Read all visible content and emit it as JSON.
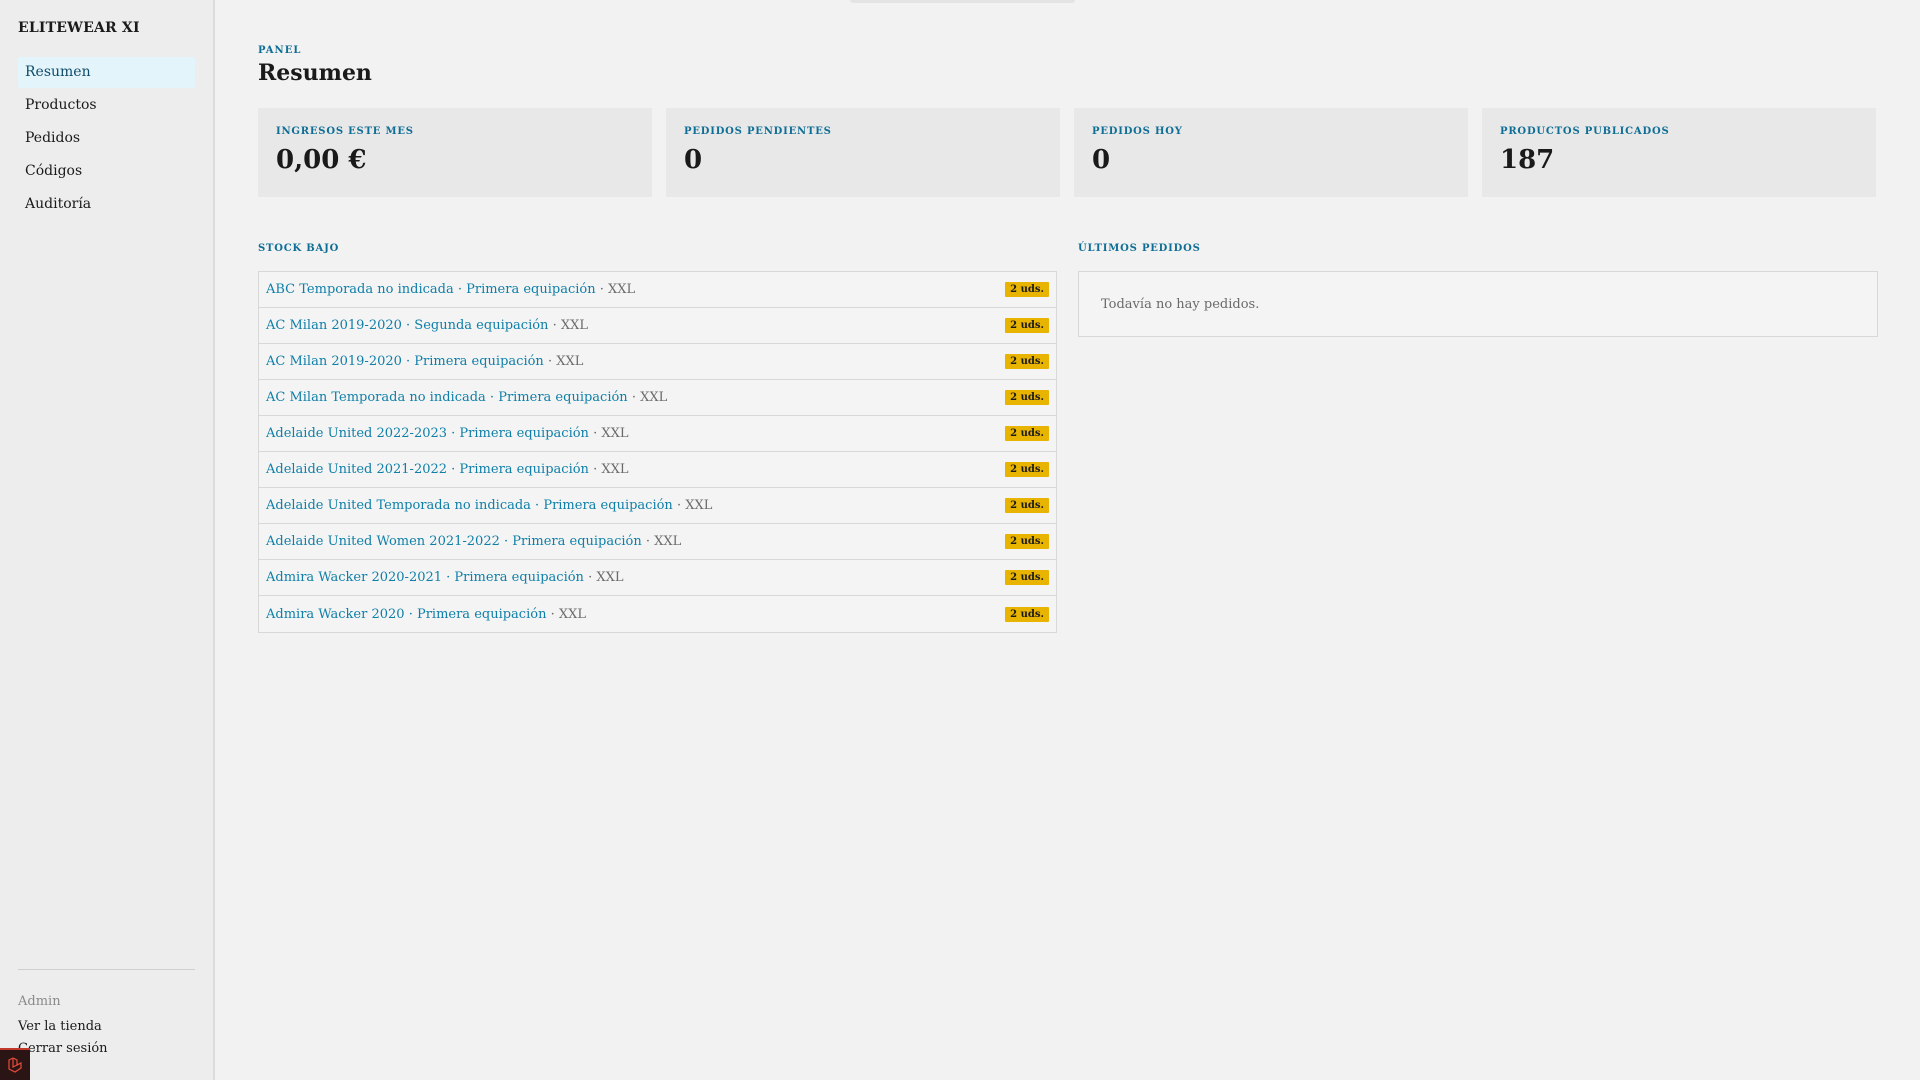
{
  "brand": "ELITEWEAR XI",
  "nav": [
    {
      "label": "Resumen",
      "active": true,
      "name": "nav-item-resumen"
    },
    {
      "label": "Productos",
      "active": false,
      "name": "nav-item-productos"
    },
    {
      "label": "Pedidos",
      "active": false,
      "name": "nav-item-pedidos"
    },
    {
      "label": "Códigos",
      "active": false,
      "name": "nav-item-codigos"
    },
    {
      "label": "Auditoría",
      "active": false,
      "name": "nav-item-auditoria"
    }
  ],
  "footer": {
    "role": "Admin",
    "view_store": "Ver la tienda",
    "logout": "Cerrar sesión"
  },
  "header": {
    "eyebrow": "PANEL",
    "title": "Resumen"
  },
  "stats": [
    {
      "label": "INGRESOS ESTE MES",
      "value": "0,00 €"
    },
    {
      "label": "PEDIDOS PENDIENTES",
      "value": "0"
    },
    {
      "label": "PEDIDOS HOY",
      "value": "0"
    },
    {
      "label": "PRODUCTOS PUBLICADOS",
      "value": "187"
    }
  ],
  "low_stock": {
    "title": "STOCK BAJO",
    "items": [
      {
        "product": "ABC Temporada no indicada · Primera equipación",
        "size": "XXL",
        "qty": "2 uds."
      },
      {
        "product": "AC Milan 2019-2020 · Segunda equipación",
        "size": "XXL",
        "qty": "2 uds."
      },
      {
        "product": "AC Milan 2019-2020 · Primera equipación",
        "size": "XXL",
        "qty": "2 uds."
      },
      {
        "product": "AC Milan Temporada no indicada · Primera equipación",
        "size": "XXL",
        "qty": "2 uds."
      },
      {
        "product": "Adelaide United 2022-2023 · Primera equipación",
        "size": "XXL",
        "qty": "2 uds."
      },
      {
        "product": "Adelaide United 2021-2022 · Primera equipación",
        "size": "XXL",
        "qty": "2 uds."
      },
      {
        "product": "Adelaide United Temporada no indicada · Primera equipación",
        "size": "XXL",
        "qty": "2 uds."
      },
      {
        "product": "Adelaide United Women 2021-2022 · Primera equipación",
        "size": "XXL",
        "qty": "2 uds."
      },
      {
        "product": "Admira Wacker 2020-2021 · Primera equipación",
        "size": "XXL",
        "qty": "2 uds."
      },
      {
        "product": "Admira Wacker 2020 · Primera equipación",
        "size": "XXL",
        "qty": "2 uds."
      }
    ]
  },
  "latest_orders": {
    "title": "ÚLTIMOS PEDIDOS",
    "empty": "Todavía no hay pedidos."
  },
  "colors": {
    "accent": "#0f7fa8",
    "active_bg": "#e3f4fb",
    "badge": "#e8b400"
  },
  "icons": {
    "corner": "framework-logo-icon"
  }
}
